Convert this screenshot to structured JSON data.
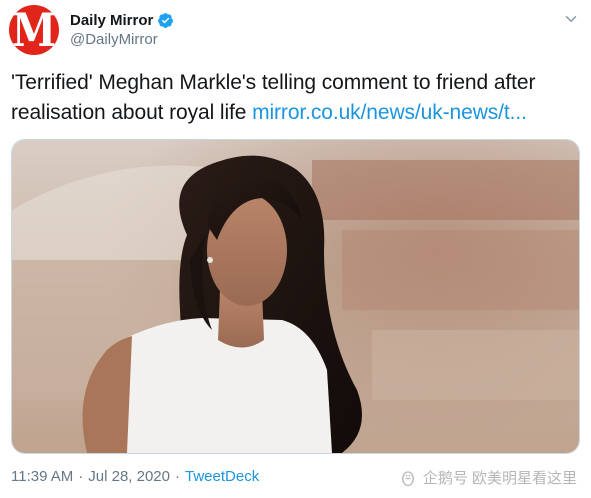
{
  "account": {
    "display_name": "Daily Mirror",
    "handle": "@DailyMirror",
    "avatar_letter": "M",
    "avatar_color": "#e1251b",
    "verified": true
  },
  "tweet": {
    "text": "'Terrified' Meghan Markle's telling comment to friend after realisation about royal life ",
    "link_text": "mirror.co.uk/news/uk-news/t...",
    "link_color": "#1b95e0"
  },
  "media": {
    "description": "photo"
  },
  "meta": {
    "time": "11:39 AM",
    "separator": "·",
    "date": "Jul 28, 2020",
    "source": "TweetDeck"
  },
  "watermark": {
    "text": "企鹅号 欧美明星看这里"
  },
  "icons": {
    "verified": "verified-badge-icon",
    "caret": "chevron-down-icon",
    "watermark": "penguin-logo-icon"
  }
}
